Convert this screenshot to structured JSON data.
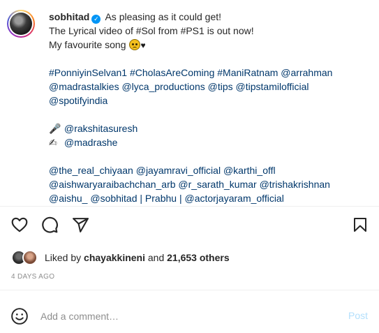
{
  "post": {
    "username": "sobhitad",
    "verified_mark": "✓",
    "caption_lines": [
      "As pleasing as it could get!",
      "The Lyrical video of #Sol from #PS1 is out now!",
      "My favourite song"
    ],
    "heart_glyph": "♥",
    "hashtags_line1": "#PonniyinSelvan1 #CholasAreComing #ManiRatnam @arrahman",
    "hashtags_line2": "@madrastalkies @lyca_productions @tips @tipstamilofficial",
    "hashtags_line3": "@spotifyindia",
    "singer_emoji": "🎤",
    "singer": "@rakshitasuresh",
    "lyricist_emoji": "✍",
    "lyricist": "@madrashe",
    "cast_line1": "@the_real_chiyaan @jayamravi_official @karthi_offl",
    "cast_line2": "@aishwaryaraibachchan_arb @r_sarath_kumar @trishakrishnan",
    "cast_line3": "@aishu_ @sobhitad | Prabhu | @actorjayaram_official"
  },
  "likes": {
    "prefix": "Liked by",
    "user": "chayakkineni",
    "connector": "and",
    "others": "21,653 others"
  },
  "timestamp": "4 DAYS AGO",
  "comment": {
    "placeholder": "Add a comment…",
    "post_label": "Post"
  },
  "icons": [
    "heart-icon",
    "comment-icon",
    "share-icon",
    "bookmark-icon",
    "emoji-icon"
  ],
  "colors": {
    "link": "#00376b",
    "verified": "#0095f6",
    "post_disabled": "#b2dffc",
    "muted": "#8e8e8e"
  }
}
